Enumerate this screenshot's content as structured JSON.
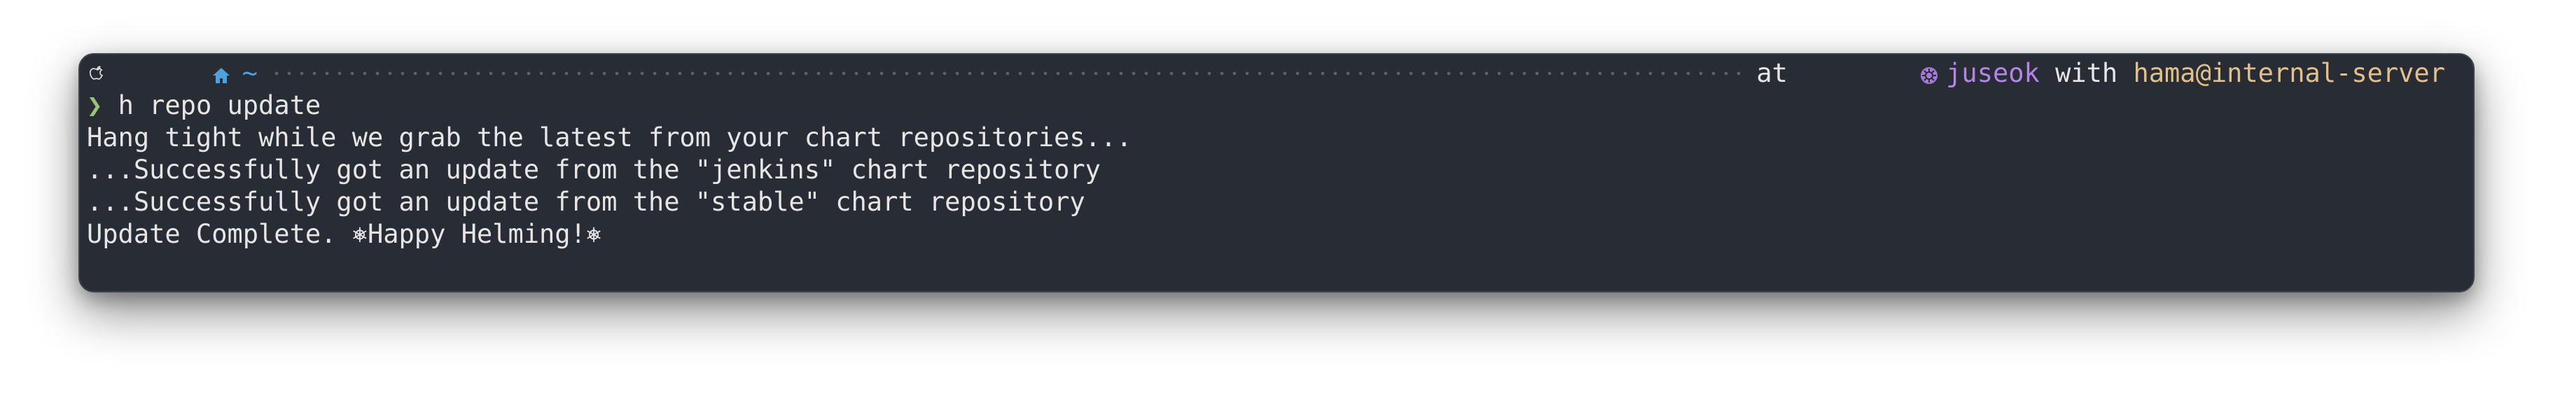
{
  "prompt": {
    "os_icon": "apple-icon",
    "home_icon": "home-icon",
    "cwd": "~",
    "at_label": "at",
    "cluster_icon": "kubernetes-icon",
    "kube_context": "juseok",
    "with_label": "with",
    "user_host": "hama@internal-server",
    "chevron": "❯"
  },
  "command": "h repo update",
  "output": [
    "Hang tight while we grab the latest from your chart repositories...",
    "...Successfully got an update from the \"jenkins\" chart repository",
    "...Successfully got an update from the \"stable\" chart repository",
    "Update Complete. ⎈Happy Helming!⎈"
  ],
  "colors": {
    "background": "#282c34",
    "text": "#e6e6e6",
    "accent_blue": "#4aa3df",
    "context_purple": "#b484e8",
    "host_tan": "#e3c08b",
    "chevron_green": "#98c379"
  }
}
